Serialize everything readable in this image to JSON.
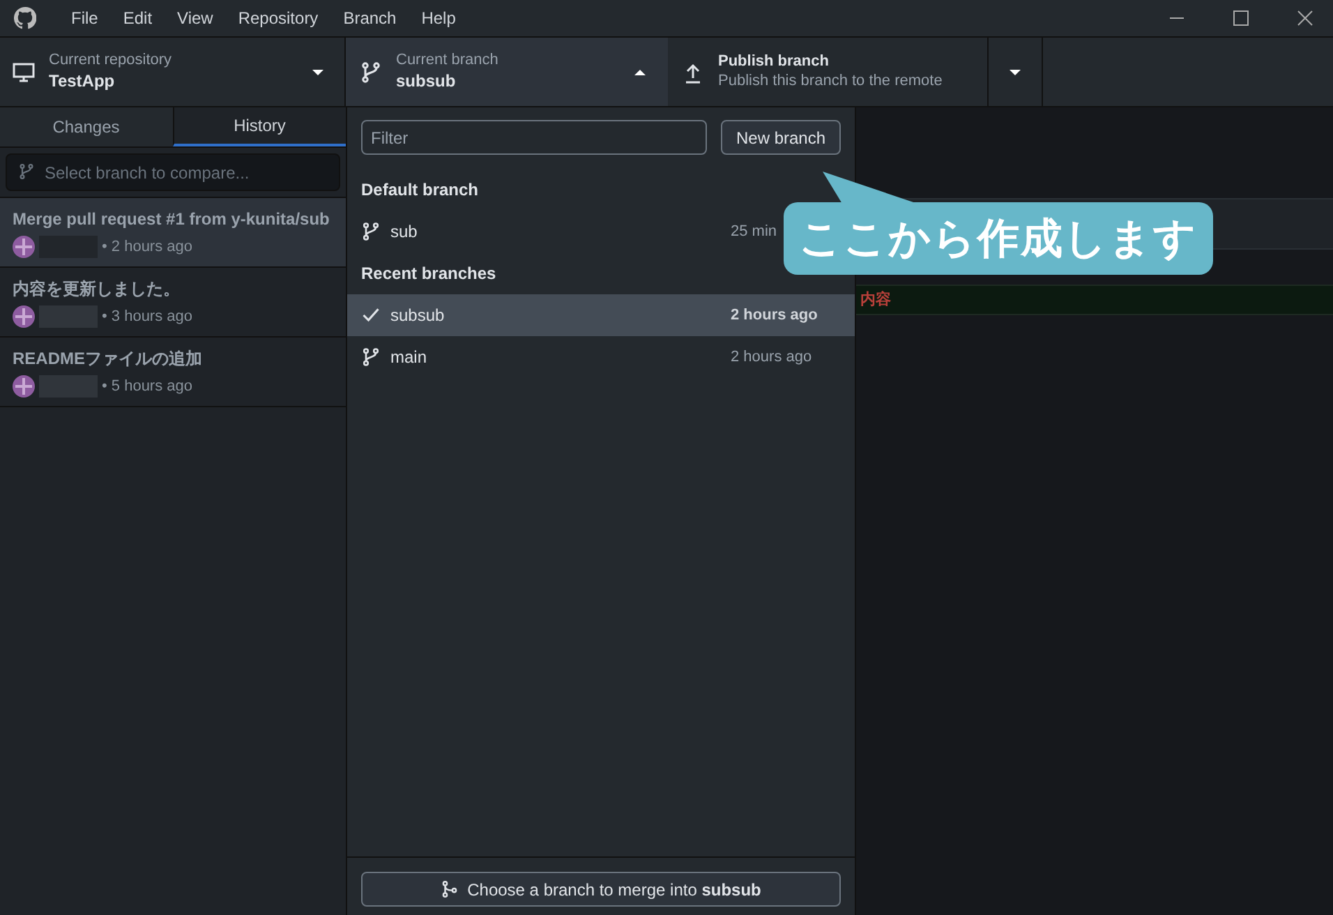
{
  "menu": [
    "File",
    "Edit",
    "View",
    "Repository",
    "Branch",
    "Help"
  ],
  "toolbar": {
    "repository": {
      "label": "Current repository",
      "value": "TestApp"
    },
    "branch": {
      "label": "Current branch",
      "value": "subsub",
      "expanded": true
    },
    "publish": {
      "title": "Publish branch",
      "subtitle": "Publish this branch to the remote"
    }
  },
  "tabs": [
    {
      "label": "Changes",
      "selected": false
    },
    {
      "label": "History",
      "selected": true
    }
  ],
  "compare": {
    "placeholder": "Select branch to compare..."
  },
  "commits": [
    {
      "title": "Merge pull request #1 from y-kunita/sub",
      "time": "• 2 hours ago",
      "selected": true
    },
    {
      "title": "内容を更新しました。",
      "time": "• 3 hours ago",
      "selected": false
    },
    {
      "title": "READMEファイルの追加",
      "time": "• 5 hours ago",
      "selected": false
    }
  ],
  "branch_menu": {
    "filter": {
      "placeholder": "Filter"
    },
    "new_button": "New branch",
    "groups": [
      {
        "heading": "Default branch",
        "items": [
          {
            "name": "sub",
            "time": "25 min",
            "selected": false
          }
        ]
      },
      {
        "heading": "Recent branches",
        "items": [
          {
            "name": "subsub",
            "time": "2 hours ago",
            "selected": true
          },
          {
            "name": "main",
            "time": "2 hours ago",
            "selected": false
          }
        ]
      }
    ],
    "merge_button": "Choose a branch to merge into **subsub**"
  },
  "diff": {
    "added_fragment": "内容"
  },
  "callout": "ここから作成します"
}
